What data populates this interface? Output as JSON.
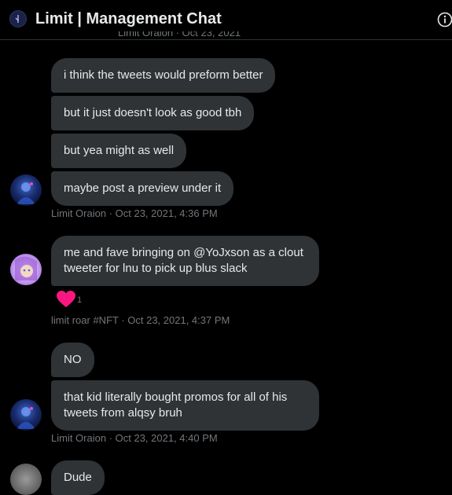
{
  "header": {
    "title": "Limit | Management Chat",
    "group_icon": "group-avatar-icon",
    "info_icon": "info-icon"
  },
  "messages": [
    {
      "text": "i think the tweets would preform better"
    },
    {
      "text": "but it just doesn't look as good tbh"
    },
    {
      "text": "but yea might as well"
    },
    {
      "text": "maybe post a preview under it"
    },
    {
      "text": "me and fave bringing on @YoJxson as a clout tweeter for lnu to pick up blus slack"
    },
    {
      "text": "NO"
    },
    {
      "text": "that kid literally bought promos for all of his tweets from alqsy bruh"
    },
    {
      "text": "Dude"
    }
  ],
  "meta": {
    "m1": "Limit Oraion · Oct 23, 2021, 4:36 PM",
    "m2": "limit roar #NFT · Oct 23, 2021, 4:37 PM",
    "m3": "Limit Oraion · Oct 23, 2021, 4:40 PM",
    "faded_top": "Limit Oraion · Oct 23, 2021"
  },
  "reaction": {
    "emoji": "heart-icon",
    "count": "1",
    "color": "#f91880"
  },
  "colors": {
    "background": "#000000",
    "bubble": "#2f3336",
    "text": "#e7e9ea",
    "meta_text": "#71767b"
  }
}
